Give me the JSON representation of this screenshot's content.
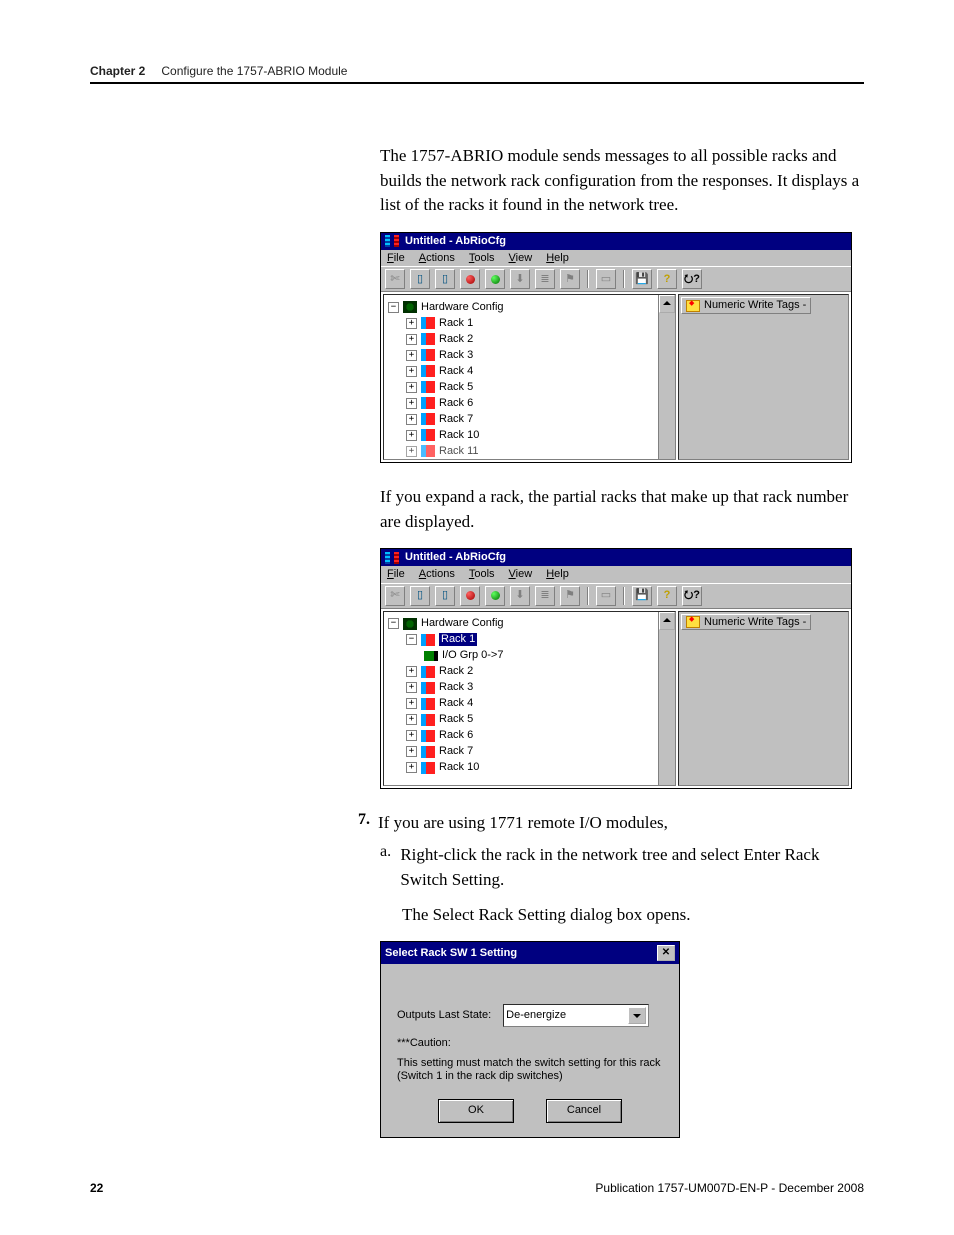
{
  "header": {
    "chapter_label": "Chapter 2",
    "chapter_title": "Configure the 1757-ABRIO Module"
  },
  "para1": "The 1757-ABRIO module sends messages to all possible racks and builds the network rack configuration from the responses. It displays a list of the racks it found in the network tree.",
  "win1": {
    "title": "Untitled - AbRioCfg",
    "menu": {
      "file": "File",
      "actions": "Actions",
      "tools": "Tools",
      "view": "View",
      "help": "Help"
    },
    "toolbar_icons": [
      "cut",
      "rack-a",
      "rack-b",
      "dot-red",
      "dot-grn",
      "hand",
      "page",
      "flag",
      "doc",
      "save",
      "help",
      "whats-this"
    ],
    "tree_root": "Hardware Config",
    "racks": [
      "Rack 1",
      "Rack 2",
      "Rack 3",
      "Rack 4",
      "Rack 5",
      "Rack 6",
      "Rack 7",
      "Rack 10",
      "Rack 11"
    ],
    "tags_button": "Numeric Write Tags -"
  },
  "para2": "If you expand a rack, the partial racks that make up that rack number are displayed.",
  "win2": {
    "title": "Untitled - AbRioCfg",
    "menu": {
      "file": "File",
      "actions": "Actions",
      "tools": "Tools",
      "view": "View",
      "help": "Help"
    },
    "tree_root": "Hardware Config",
    "selected": "Rack 1",
    "child": "I/O Grp 0->7",
    "racks": [
      "Rack 2",
      "Rack 3",
      "Rack 4",
      "Rack 5",
      "Rack 6",
      "Rack 7",
      "Rack 10"
    ],
    "tags_button": "Numeric Write Tags -"
  },
  "step7": {
    "num": "7.",
    "text": "If you are using 1771 remote I/O modules,"
  },
  "step7a": {
    "label": "a.",
    "text": "Right-click the rack in the network tree and select Enter Rack Switch Setting."
  },
  "step7a2": "The Select Rack Setting dialog box opens.",
  "dlg": {
    "title": "Select Rack SW 1 Setting",
    "label": "Outputs Last State:",
    "value": "De-energize",
    "caution_label": "***Caution:",
    "caution_text": "This setting must match the switch setting for this rack (Switch 1 in the rack dip switches)",
    "ok": "OK",
    "cancel": "Cancel"
  },
  "footer": {
    "page": "22",
    "pub": "Publication 1757-UM007D-EN-P - December 2008"
  }
}
